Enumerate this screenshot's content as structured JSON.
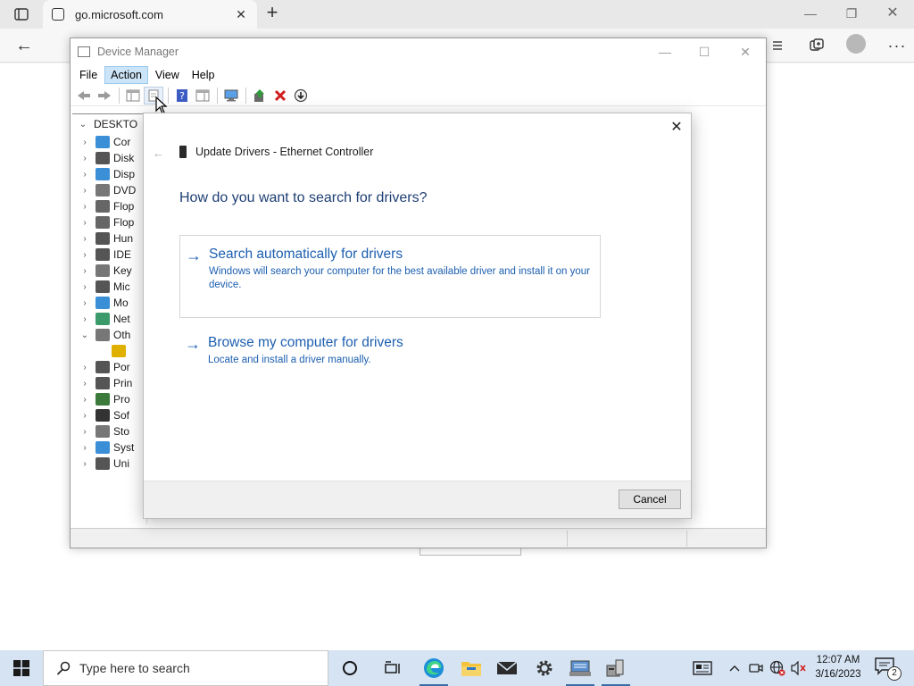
{
  "browser": {
    "tab_title": "go.microsoft.com",
    "new_tab_symbol": "+",
    "tab_close_symbol": "✕",
    "back_symbol": "←",
    "min_symbol": "—",
    "max_symbol": "❐",
    "close_symbol": "✕",
    "more_symbol": "···"
  },
  "device_manager": {
    "title": "Device Manager",
    "menu": [
      "File",
      "Action",
      "View",
      "Help"
    ],
    "active_menu": "Action",
    "tree_root": "DESKTO",
    "tree_items": [
      {
        "label": "Cor",
        "chev": "›",
        "color": "#3b8fd6"
      },
      {
        "label": "Disk",
        "chev": "›",
        "color": "#555555"
      },
      {
        "label": "Disp",
        "chev": "›",
        "color": "#3b8fd6"
      },
      {
        "label": "DVD",
        "chev": "›",
        "color": "#777777"
      },
      {
        "label": "Flop",
        "chev": "›",
        "color": "#666666"
      },
      {
        "label": "Flop",
        "chev": "›",
        "color": "#666666"
      },
      {
        "label": "Hun",
        "chev": "›",
        "color": "#555555"
      },
      {
        "label": "IDE",
        "chev": "›",
        "color": "#555555"
      },
      {
        "label": "Key",
        "chev": "›",
        "color": "#777777"
      },
      {
        "label": "Mic",
        "chev": "›",
        "color": "#555555"
      },
      {
        "label": "Mo",
        "chev": "›",
        "color": "#3b8fd6"
      },
      {
        "label": "Net",
        "chev": "›",
        "color": "#3b9a6a"
      },
      {
        "label": "Oth",
        "chev": "⌄",
        "color": "#777777"
      },
      {
        "label": "",
        "chev": "",
        "color": "#e0b000"
      },
      {
        "label": "Por",
        "chev": "›",
        "color": "#555555"
      },
      {
        "label": "Prin",
        "chev": "›",
        "color": "#555555"
      },
      {
        "label": "Pro",
        "chev": "›",
        "color": "#3b7a3b"
      },
      {
        "label": "Sof",
        "chev": "›",
        "color": "#333333"
      },
      {
        "label": "Sto",
        "chev": "›",
        "color": "#777777"
      },
      {
        "label": "Syst",
        "chev": "›",
        "color": "#3b8fd6"
      },
      {
        "label": "Uni",
        "chev": "›",
        "color": "#555555"
      }
    ]
  },
  "dialog": {
    "close_symbol": "✕",
    "back_symbol": "←",
    "header": "Update Drivers - Ethernet Controller",
    "question": "How do you want to search for drivers?",
    "options": [
      {
        "arrow": "→",
        "title": "Search automatically for drivers",
        "description": "Windows will search your computer for the best available driver and install it on your device."
      },
      {
        "arrow": "→",
        "title": "Browse my computer for drivers",
        "description": "Locate and install a driver manually."
      }
    ],
    "cancel_label": "Cancel"
  },
  "taskbar": {
    "search_placeholder": "Type here to search",
    "time": "12:07 AM",
    "date": "3/16/2023",
    "notification_count": "2"
  },
  "colors": {
    "accent_link": "#1c5fb0",
    "question_text": "#1e3f74",
    "taskbar_bg": "#d5e3f3",
    "menu_highlight": "#cce4f7"
  }
}
